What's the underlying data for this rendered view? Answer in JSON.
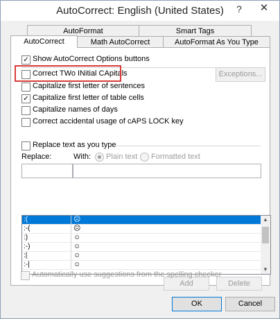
{
  "window": {
    "title": "AutoCorrect: English (United States)",
    "help": "?",
    "close": "✕"
  },
  "tabs": {
    "autoformat": "AutoFormat",
    "smart_tags": "Smart Tags",
    "autocorrect": "AutoCorrect",
    "math_autocorrect": "Math AutoCorrect",
    "autoformat_as_you_type": "AutoFormat As You Type"
  },
  "options": {
    "show_buttons": "Show AutoCorrect Options buttons",
    "two_initial": "Correct TWo INitial CApitals",
    "first_letter_sentences": "Capitalize first letter of sentences",
    "first_letter_table": "Capitalize first letter of table cells",
    "names_of_days": "Capitalize names of days",
    "caps_lock": "Correct accidental usage of cAPS LOCK key",
    "exceptions": "Exceptions...",
    "check": "✓"
  },
  "replace": {
    "replace_as_you_type": "Replace text as you type",
    "replace_label": "Replace:",
    "with_label": "With:",
    "plain_text": "Plain text",
    "formatted_text": "Formatted text"
  },
  "list": {
    "rows": [
      {
        "from": ":(",
        "to": "☹"
      },
      {
        "from": ":-(",
        "to": "☹"
      },
      {
        "from": ":)",
        "to": "☺"
      },
      {
        "from": ":-)",
        "to": "☺"
      },
      {
        "from": ":|",
        "to": "☺"
      },
      {
        "from": ":-|",
        "to": "☺"
      }
    ]
  },
  "actions": {
    "add": "Add",
    "delete": "Delete",
    "auto_suggest": "Automatically use suggestions from the spelling checker"
  },
  "footer": {
    "ok": "OK",
    "cancel": "Cancel"
  }
}
